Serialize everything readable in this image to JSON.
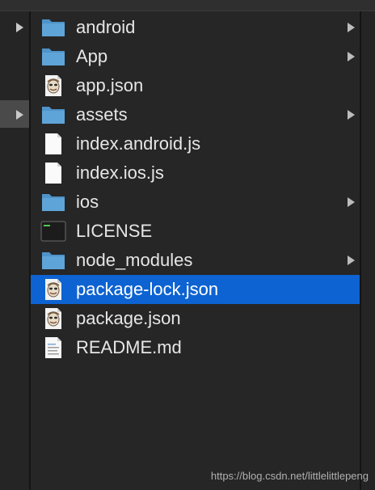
{
  "colors": {
    "selection": "#0d63d1",
    "folder": "#5ea4d8",
    "background": "#262626",
    "text": "#e6e6e6"
  },
  "files": [
    {
      "label": "android",
      "icon": "folder-icon",
      "has_children": true
    },
    {
      "label": "App",
      "icon": "folder-icon",
      "has_children": true
    },
    {
      "label": "app.json",
      "icon": "json-file-icon",
      "has_children": false
    },
    {
      "label": "assets",
      "icon": "folder-icon",
      "has_children": true
    },
    {
      "label": "index.android.js",
      "icon": "blank-file-icon",
      "has_children": false
    },
    {
      "label": "index.ios.js",
      "icon": "blank-file-icon",
      "has_children": false
    },
    {
      "label": "ios",
      "icon": "folder-icon",
      "has_children": true
    },
    {
      "label": "LICENSE",
      "icon": "terminal-file-icon",
      "has_children": false
    },
    {
      "label": "node_modules",
      "icon": "folder-icon",
      "has_children": true
    },
    {
      "label": "package-lock.json",
      "icon": "json-file-icon",
      "has_children": false,
      "selected": true
    },
    {
      "label": "package.json",
      "icon": "json-file-icon",
      "has_children": false
    },
    {
      "label": "README.md",
      "icon": "text-file-icon",
      "has_children": false
    }
  ],
  "watermark": "https://blog.csdn.net/littlelittlepeng"
}
